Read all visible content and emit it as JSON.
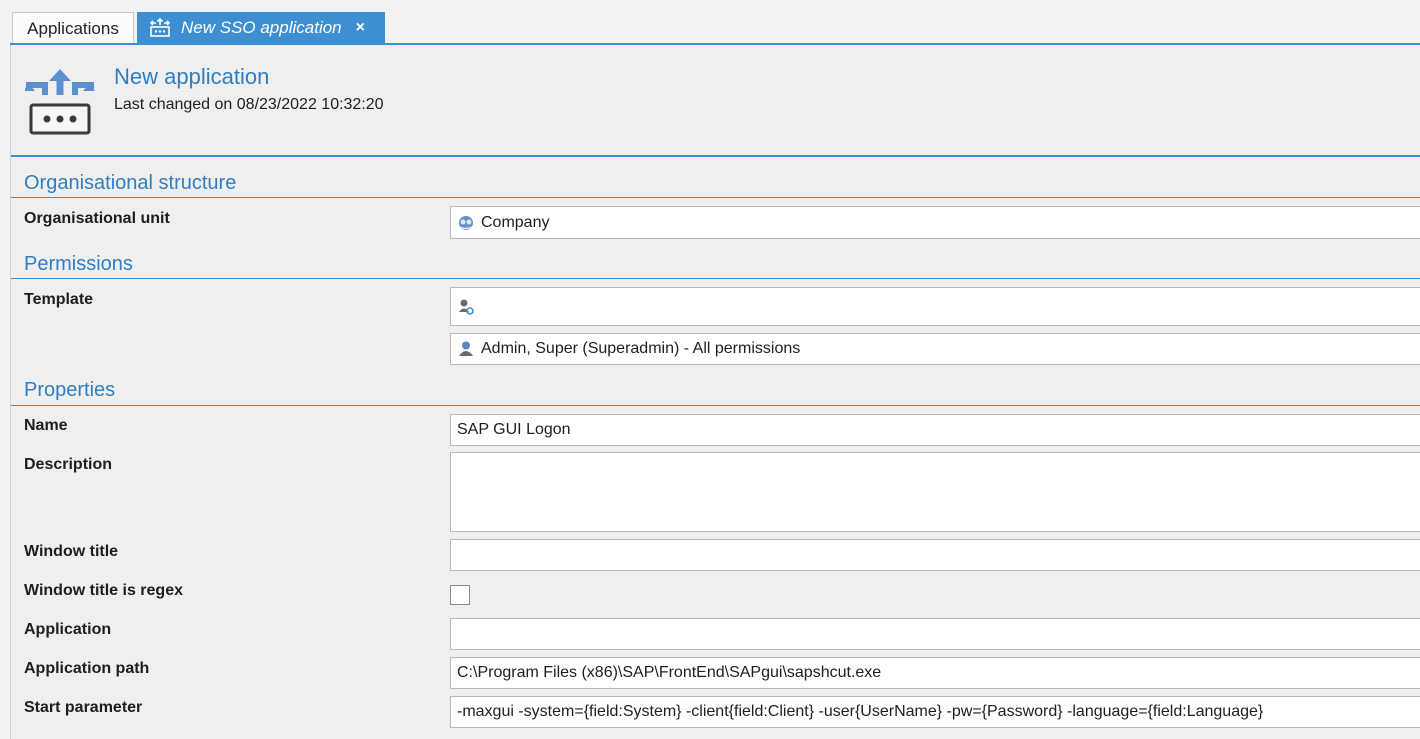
{
  "tabs": {
    "applications": "Applications",
    "sso": "New SSO application",
    "close": "×"
  },
  "header": {
    "title": "New application",
    "subtitle": "Last changed on 08/23/2022 10:32:20",
    "icon": "sso-application-icon"
  },
  "sections": {
    "org": "Organisational structure",
    "permissions": "Permissions",
    "properties": "Properties"
  },
  "org": {
    "unit_label": "Organisational unit",
    "unit_value": "Company"
  },
  "permissions": {
    "template_label": "Template",
    "template_value": "",
    "user_value": "Admin, Super (Superadmin) - All permissions"
  },
  "properties": {
    "name_label": "Name",
    "name_value": "SAP GUI Logon",
    "description_label": "Description",
    "description_value": "",
    "window_title_label": "Window title",
    "window_title_value": "",
    "window_regex_label": "Window title is regex",
    "application_label": "Application",
    "application_value": "",
    "path_label": "Application path",
    "path_value": "C:\\Program Files (x86)\\SAP\\FrontEnd\\SAPgui\\sapshcut.exe",
    "start_label": "Start parameter",
    "start_value": "-maxgui -system={field:System} -client{field:Client} -user{UserName} -pw={Password} -language={field:Language}"
  },
  "colors": {
    "accent": "#3d8fd1",
    "title": "#2f7ec4"
  }
}
